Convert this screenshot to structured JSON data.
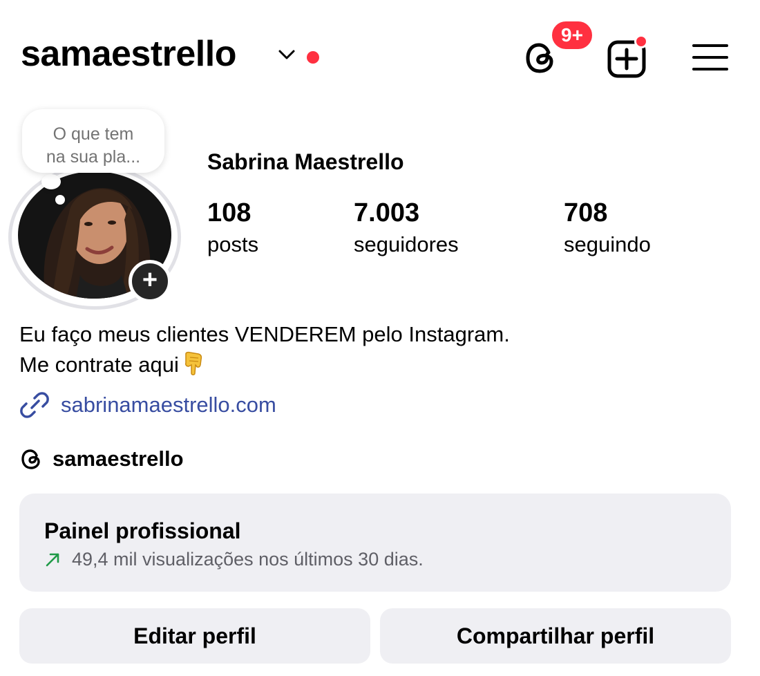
{
  "header": {
    "username": "samaestrello",
    "threads_badge": "9+"
  },
  "profile": {
    "note": [
      "O que tem",
      "na sua pla..."
    ],
    "display_name": "Sabrina Maestrello",
    "stats": [
      {
        "value": "108",
        "label": "posts"
      },
      {
        "value": "7.003",
        "label": "seguidores"
      },
      {
        "value": "708",
        "label": "seguindo"
      }
    ],
    "bio": [
      "Eu faço meus clientes VENDEREM pelo Instagram.",
      "Me contrate aqui"
    ],
    "bio_emoji": "backhand-index-pointing-down",
    "link": "sabrinamaestrello.com",
    "threads_handle": "samaestrello"
  },
  "dashboard": {
    "title": "Painel profissional",
    "subtitle": "49,4 mil visualizações nos últimos 30 dias."
  },
  "buttons": {
    "edit": "Editar perfil",
    "share": "Compartilhar perfil"
  },
  "colors": {
    "notification_red": "#ff3040",
    "link_blue": "#384da1",
    "trend_green": "#1f9a47",
    "panel_gray": "#efeff3"
  }
}
